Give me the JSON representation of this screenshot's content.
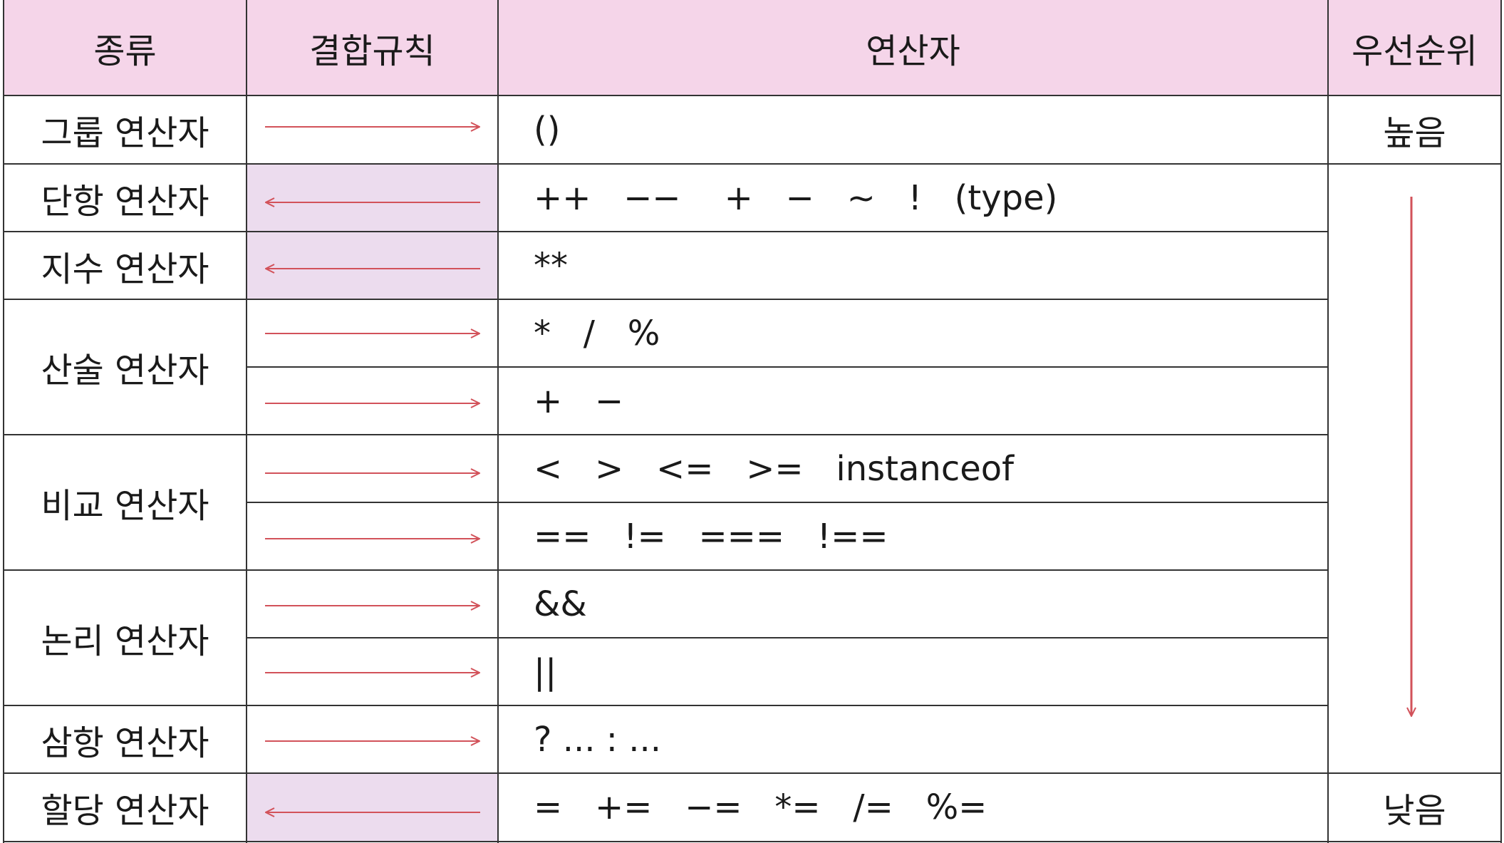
{
  "header": {
    "kind": "종류",
    "assoc": "결합규칙",
    "operators": "연산자",
    "priority": "우선순위"
  },
  "rows": [
    {
      "kind": "그룹 연산자",
      "assoc": "right",
      "operators": "()"
    },
    {
      "kind": "단항 연산자",
      "assoc": "left",
      "operators": "++   −−    +   −   ~   !   (type)"
    },
    {
      "kind": "지수 연산자",
      "assoc": "left",
      "operators": "**"
    },
    {
      "kind": "산술 연산자",
      "assoc": "right",
      "operators": "*   /   %"
    },
    {
      "kind": "",
      "assoc": "right",
      "operators": "+   −"
    },
    {
      "kind": "비교 연산자",
      "assoc": "right",
      "operators": "<   >   <=   >=   instanceof"
    },
    {
      "kind": "",
      "assoc": "right",
      "operators": "==   !=   ===   !=="
    },
    {
      "kind": "논리 연산자",
      "assoc": "right",
      "operators": "&&"
    },
    {
      "kind": "",
      "assoc": "right",
      "operators": "||"
    },
    {
      "kind": "삼항 연산자",
      "assoc": "right",
      "operators": "? ... : ..."
    },
    {
      "kind": "할당 연산자",
      "assoc": "left",
      "operators": "=   +=   −=   *=   /=   %="
    }
  ],
  "priority": {
    "high": "높음",
    "low": "낮음"
  },
  "colors": {
    "header_bg": "#f5d5e9",
    "left_assoc_bg": "#ecdcee",
    "arrow": "#d2525a",
    "grid": "#333333"
  }
}
